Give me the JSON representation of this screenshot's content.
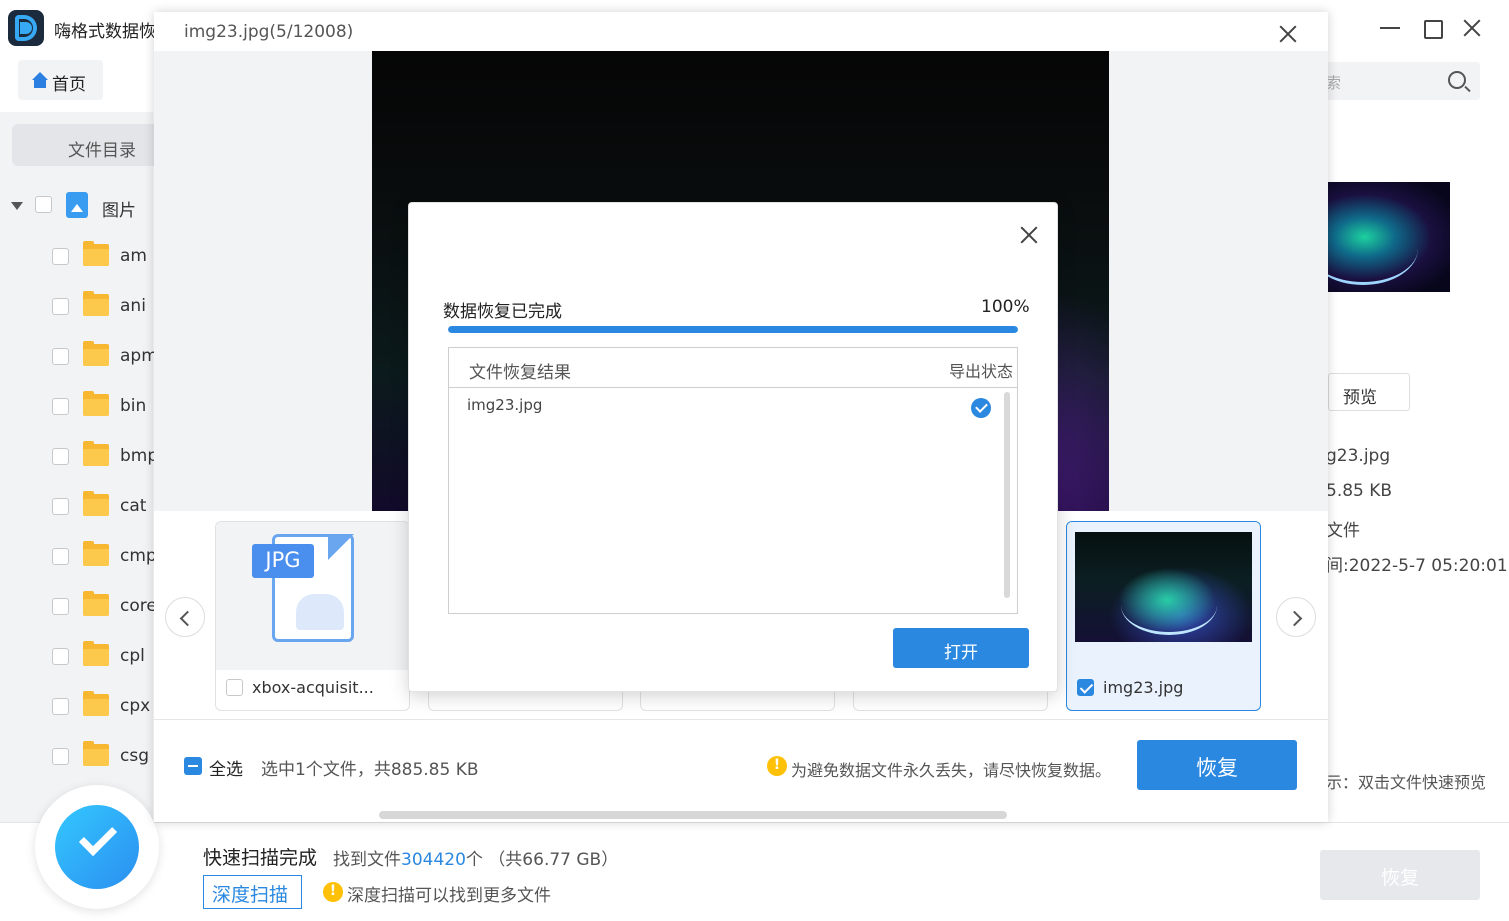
{
  "app": {
    "title": "嗨格式数据恢",
    "ghost_char": "ı"
  },
  "nav": {
    "home_label": "首页"
  },
  "search": {
    "placeholder": "索"
  },
  "sidebar": {
    "header": "文件目录",
    "root": "图片",
    "folders": [
      "am",
      "ani",
      "apm",
      "bin",
      "bmp",
      "cat",
      "cmp",
      "core",
      "cpl",
      "cpx",
      "csg"
    ]
  },
  "details": {
    "preview_label": "预览",
    "name": "g23.jpg",
    "size": "5.85 KB",
    "type": "文件",
    "time": "间:2022-5-7 05:20:01",
    "tip": "示：双击文件快速预览"
  },
  "bottom": {
    "scan_done": "快速扫描完成",
    "found_prefix": "找到文件",
    "found_count": "304420",
    "found_suffix": "个 （共66.77 GB）",
    "deep_scan_label": "深度扫描",
    "deep_hint": "深度扫描可以找到更多文件",
    "recover_label": "恢复"
  },
  "preview": {
    "title": "img23.jpg(5/12008)",
    "thumbs": [
      {
        "label": "xbox-acquisit...",
        "type_tag": "JPG",
        "checked": false
      },
      {
        "label": "img23.jpg",
        "checked": true
      }
    ],
    "select_all_label": "全选",
    "selection_summary": "选中1个文件，共885.85 KB",
    "warning": "为避免数据文件永久丢失，请尽快恢复数据。",
    "recover_label": "恢复"
  },
  "dialog": {
    "status": "数据恢复已完成",
    "percent_text": "100%",
    "progress": 1.0,
    "table": {
      "col_name": "文件恢复结果",
      "col_state": "导出状态",
      "rows": [
        {
          "name": "img23.jpg",
          "state_icon": "check-circle-icon"
        }
      ]
    },
    "open_label": "打开"
  },
  "colors": {
    "accent": "#2a88e0",
    "warning": "#ffc107",
    "folder": "#f7b731"
  }
}
